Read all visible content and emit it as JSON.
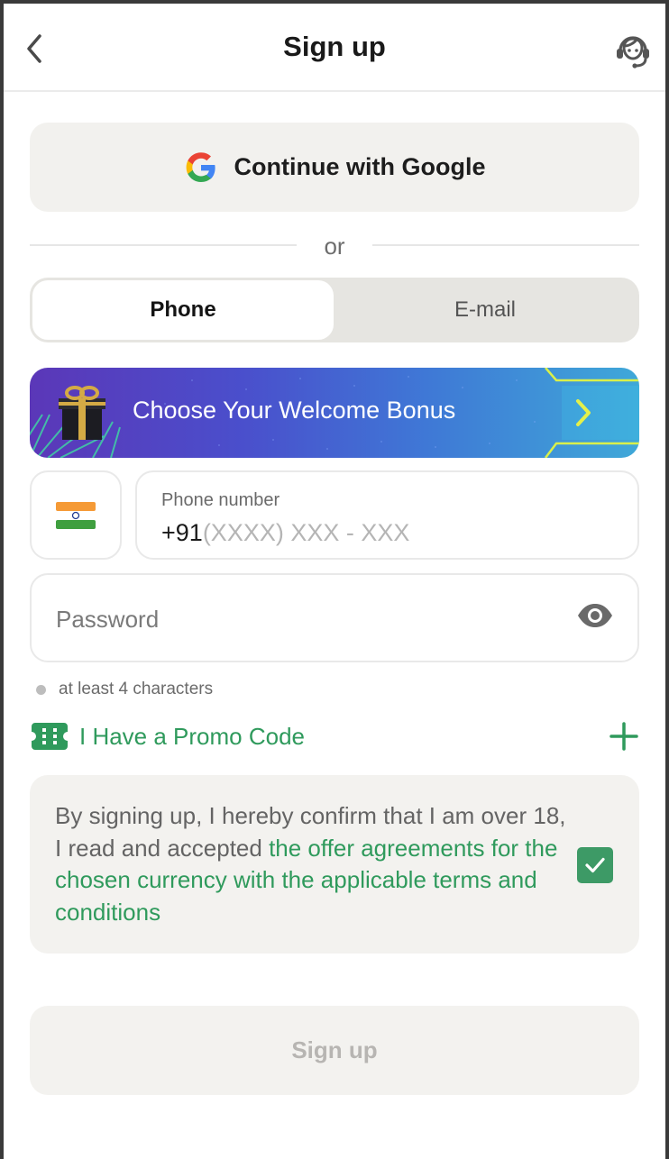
{
  "header": {
    "title": "Sign up",
    "back_icon": "chevron-left-icon",
    "support_icon": "headset-support-icon"
  },
  "google": {
    "label": "Continue with Google",
    "icon": "google-logo-icon"
  },
  "divider": {
    "label": "or"
  },
  "tabs": [
    {
      "label": "Phone",
      "active": true
    },
    {
      "label": "E-mail",
      "active": false
    }
  ],
  "bonus": {
    "label": "Choose Your Welcome Bonus",
    "icon": "gift-box-icon",
    "arrow_icon": "chevron-right-icon"
  },
  "phone": {
    "country_flag": "india-flag-icon",
    "label": "Phone number",
    "prefix": "+91",
    "placeholder": "(XXXX) XXX - XXX"
  },
  "password": {
    "placeholder": "Password",
    "toggle_icon": "eye-icon",
    "hint": "at least 4 characters"
  },
  "promo": {
    "label": "I Have a Promo Code",
    "icon": "ticket-icon",
    "expand_icon": "plus-icon"
  },
  "terms": {
    "text_prefix": "By signing up, I hereby confirm that I am over 18, I read and accepted ",
    "link_text": "the offer agreements for the chosen currency with the applicable terms and conditions",
    "checked": true
  },
  "signup_button": {
    "label": "Sign up",
    "enabled": false
  },
  "colors": {
    "accent_green": "#2f9a5c",
    "checkbox_green": "#3d9a66",
    "surface": "#f2f1ee"
  }
}
